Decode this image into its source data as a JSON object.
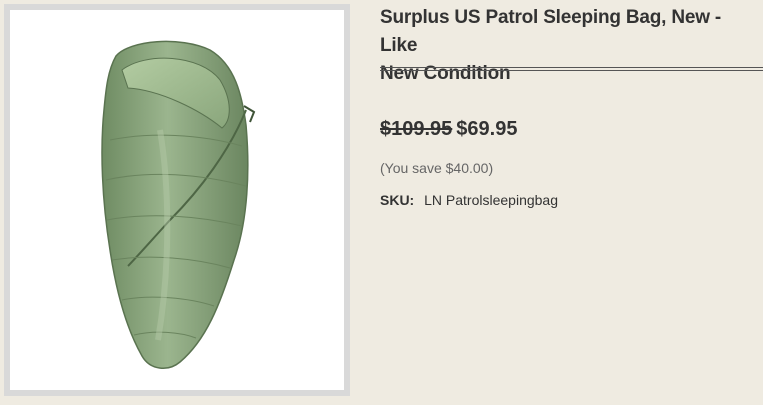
{
  "product": {
    "image_alt": "sleeping-bag-photo",
    "title": "Surplus US Patrol Sleeping Bag, New - Like\nNew Condition",
    "price_original": "$109.95",
    "price_sale": "$69.95",
    "savings": "(You save $40.00)",
    "sku_label": "SKU:",
    "sku_value": "LN Patrolsleepingbag"
  },
  "colors": {
    "page_background": "#efebe1",
    "bag_green": "#8ea882",
    "text_dark": "#333333"
  }
}
